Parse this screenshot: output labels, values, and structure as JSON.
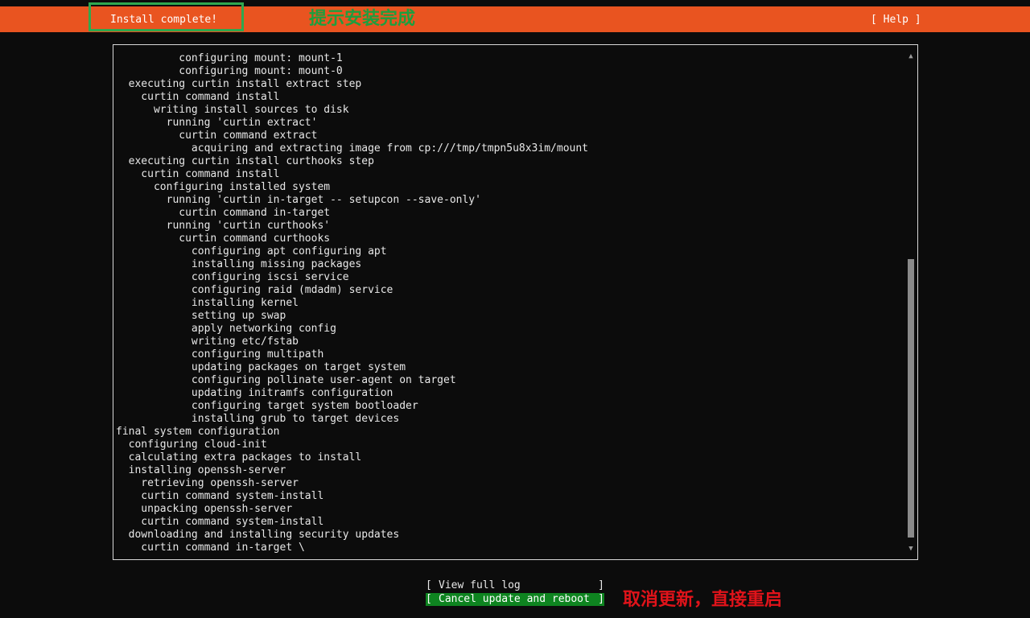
{
  "header": {
    "title": "Install complete!",
    "help_label": "[ Help ]",
    "accent_color": "#e95420"
  },
  "annotations": {
    "top": "提示安装完成",
    "bottom": "取消更新，直接重启",
    "top_color": "#1e9e3e",
    "bottom_color": "#e0131a"
  },
  "log": {
    "lines": [
      "          configuring mount: mount-1",
      "          configuring mount: mount-0",
      "  executing curtin install extract step",
      "    curtin command install",
      "      writing install sources to disk",
      "        running 'curtin extract'",
      "          curtin command extract",
      "            acquiring and extracting image from cp:///tmp/tmpn5u8x3im/mount",
      "  executing curtin install curthooks step",
      "    curtin command install",
      "      configuring installed system",
      "        running 'curtin in-target -- setupcon --save-only'",
      "          curtin command in-target",
      "        running 'curtin curthooks'",
      "          curtin command curthooks",
      "            configuring apt configuring apt",
      "            installing missing packages",
      "            configuring iscsi service",
      "            configuring raid (mdadm) service",
      "            installing kernel",
      "            setting up swap",
      "            apply networking config",
      "            writing etc/fstab",
      "            configuring multipath",
      "            updating packages on target system",
      "            configuring pollinate user-agent on target",
      "            updating initramfs configuration",
      "            configuring target system bootloader",
      "            installing grub to target devices",
      "final system configuration",
      "  configuring cloud-init",
      "  calculating extra packages to install",
      "  installing openssh-server",
      "    retrieving openssh-server",
      "    curtin command system-install",
      "    unpacking openssh-server",
      "    curtin command system-install",
      "  downloading and installing security updates",
      "    curtin command in-target \\"
    ],
    "scroll": {
      "up_icon": "▲",
      "down_icon": "▼",
      "thumb_start": 0.41,
      "thumb_end": 0.99
    }
  },
  "actions": {
    "view_log": "View full log",
    "reboot": "Cancel update and reboot",
    "bracket_left": "[",
    "bracket_right": "]",
    "selected_color": "#0e8420"
  }
}
